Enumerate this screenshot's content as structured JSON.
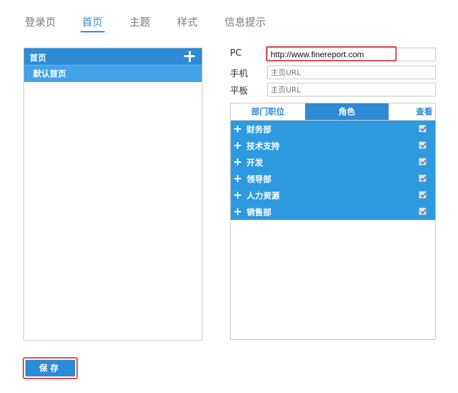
{
  "tabs": [
    {
      "label": "登录页",
      "active": false
    },
    {
      "label": "首页",
      "active": true
    },
    {
      "label": "主题",
      "active": false
    },
    {
      "label": "样式",
      "active": false
    },
    {
      "label": "信息提示",
      "active": false
    }
  ],
  "left_panel": {
    "header": "首页",
    "add_icon": "plus-icon",
    "items": [
      "默认首页"
    ]
  },
  "fields": {
    "pc": {
      "label": "PC",
      "value": "http://www.finereport.com",
      "placeholder": "主页URL"
    },
    "mobile": {
      "label": "手机",
      "value": "",
      "placeholder": "主页URL"
    },
    "tablet": {
      "label": "平板",
      "value": "",
      "placeholder": "主页URL"
    }
  },
  "perm": {
    "tabs": [
      "部门职位",
      "角色",
      "查看"
    ],
    "active_tab": "角色",
    "rows": [
      {
        "label": "财务部",
        "checked": true
      },
      {
        "label": "技术支持",
        "checked": true
      },
      {
        "label": "开发",
        "checked": true
      },
      {
        "label": "领导部",
        "checked": true
      },
      {
        "label": "人力资源",
        "checked": true
      },
      {
        "label": "销售部",
        "checked": true
      }
    ]
  },
  "save_label": "保存",
  "colors": {
    "accent": "#2d8bd6",
    "row_bg": "#2d9ae0",
    "highlight": "#e34b4b"
  }
}
